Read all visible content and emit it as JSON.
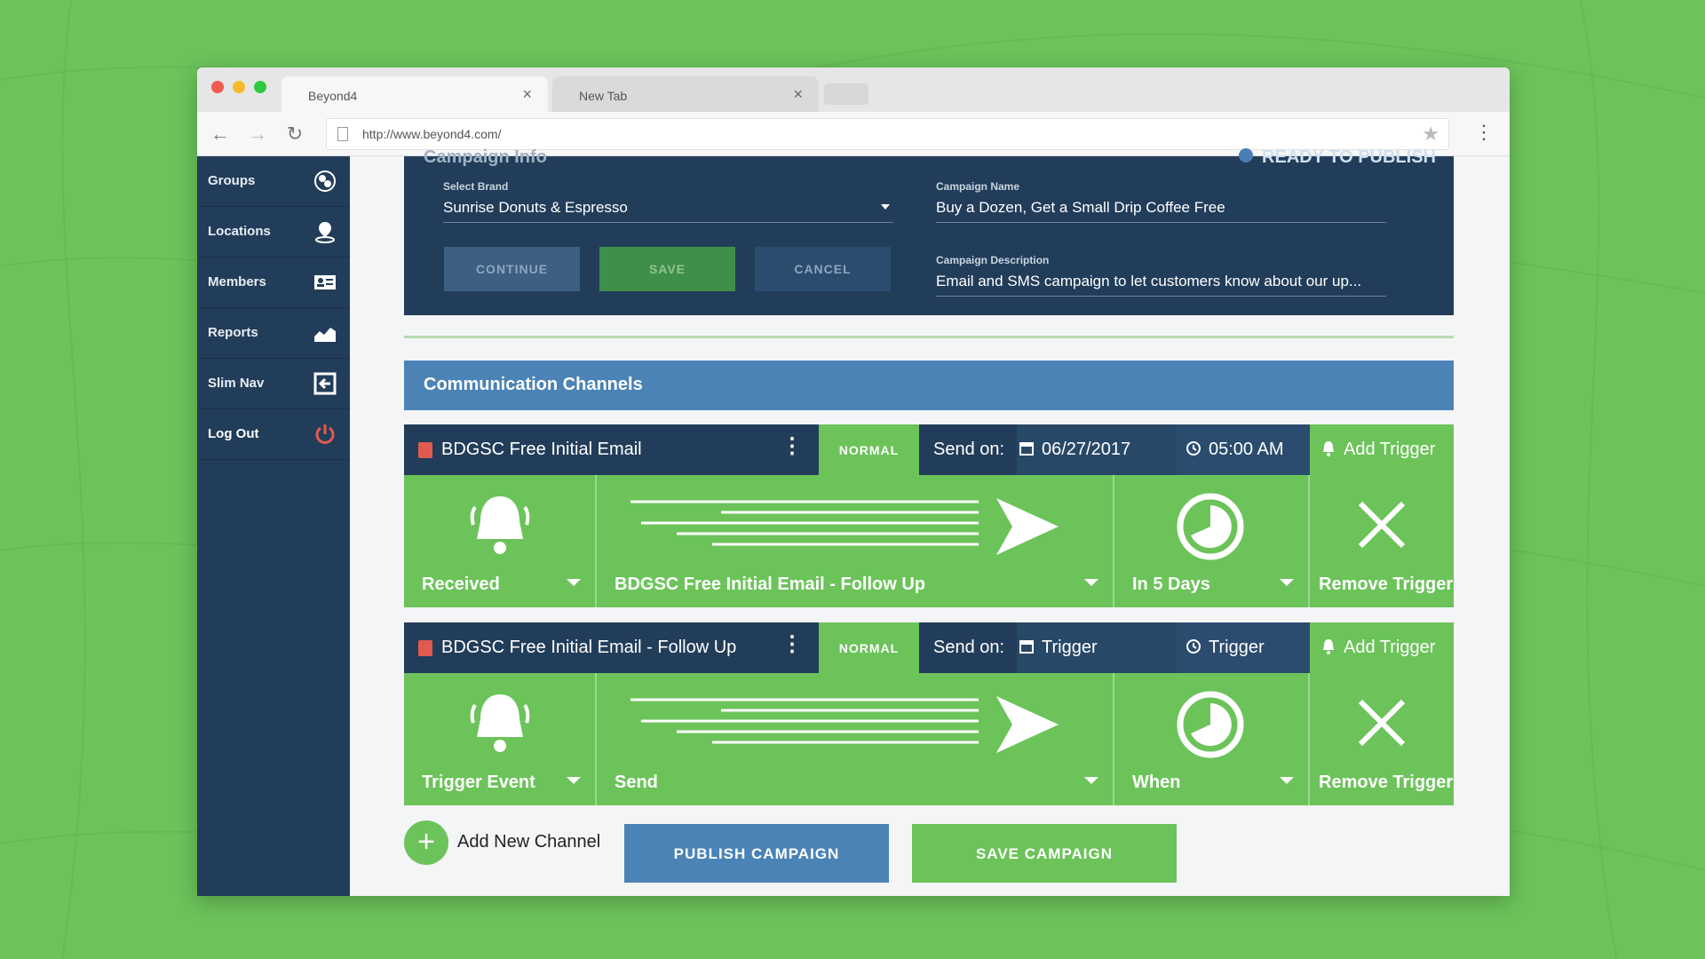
{
  "colors": {
    "background": "#6cc35a",
    "navy": "#223d5a",
    "green": "#6cc35a",
    "blue": "#4b83b6",
    "red": "#e05b4f"
  },
  "browser": {
    "tabs": [
      {
        "title": "Beyond4",
        "active": true
      },
      {
        "title": "New Tab",
        "active": false
      }
    ],
    "url": "http://www.beyond4.com/"
  },
  "sidebar": {
    "items": [
      {
        "label": "Groups",
        "icon": "groups-icon"
      },
      {
        "label": "Locations",
        "icon": "location-pin-icon"
      },
      {
        "label": "Members",
        "icon": "id-card-icon"
      },
      {
        "label": "Reports",
        "icon": "chart-icon"
      },
      {
        "label": "Slim Nav",
        "icon": "collapse-icon"
      },
      {
        "label": "Log Out",
        "icon": "power-icon"
      }
    ]
  },
  "campaign_info": {
    "title": "Campaign Info",
    "status": "READY TO PUBLISH",
    "brand_label": "Select Brand",
    "brand_value": "Sunrise Donuts & Espresso",
    "name_label": "Campaign Name",
    "name_value": "Buy a Dozen, Get a Small Drip Coffee Free",
    "description_label": "Campaign Description",
    "description_value": "Email and SMS campaign to let customers know about our up...",
    "buttons": {
      "continue": "CONTINUE",
      "save": "SAVE",
      "cancel": "CANCEL"
    }
  },
  "channels_header": "Communication Channels",
  "channels": [
    {
      "name": "BDGSC Free Initial Email",
      "priority": "NORMAL",
      "send_on_label": "Send on:",
      "date": "06/27/2017",
      "time": "05:00 AM",
      "add_trigger": "Add Trigger",
      "event": "Received",
      "action": "BDGSC Free Initial Email - Follow Up",
      "delay": "In 5 Days",
      "remove": "Remove Trigger"
    },
    {
      "name": "BDGSC Free Initial Email - Follow Up",
      "priority": "NORMAL",
      "send_on_label": "Send on:",
      "date": "Trigger",
      "time": "Trigger",
      "add_trigger": "Add Trigger",
      "event": "Trigger Event",
      "action": "Send",
      "delay": "When",
      "remove": "Remove Trigger"
    }
  ],
  "footer": {
    "add_channel": "Add New Channel",
    "publish": "PUBLISH CAMPAIGN",
    "save": "SAVE CAMPAIGN"
  }
}
